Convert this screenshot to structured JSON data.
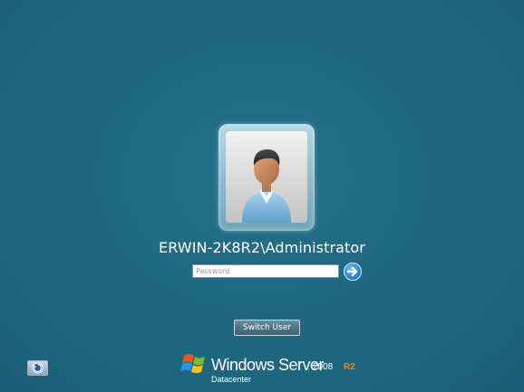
{
  "login": {
    "username": "ERWIN-2K8R2\\Administrator",
    "password_placeholder": "Password",
    "password_value": "",
    "submit_icon": "arrow-right-icon",
    "switch_user_label": "Switch User"
  },
  "avatar": {
    "icon": "user-avatar-icon"
  },
  "ease_of_access": {
    "icon": "ease-of-access-icon"
  },
  "branding": {
    "product_name": "Windows Server",
    "version": "2008",
    "release": "R2",
    "edition": "Datacenter",
    "logo_icon": "windows-flag-icon"
  },
  "colors": {
    "background": "#1f6780",
    "r2_accent": "#e8872a",
    "submit_button": "#2f86d0"
  }
}
